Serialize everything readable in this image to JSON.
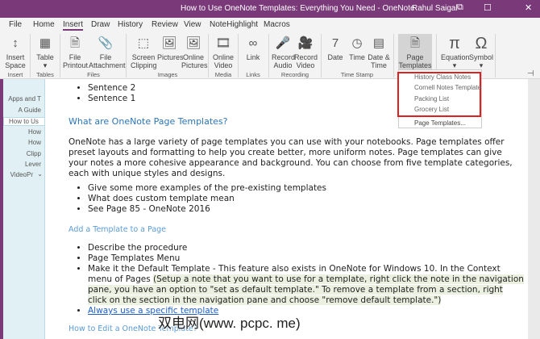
{
  "window": {
    "title": "How to Use OneNote Templates: Everything You Need  -  OneNote",
    "user": "Rahul Saigal"
  },
  "tabs": [
    "File",
    "Home",
    "Insert",
    "Draw",
    "History",
    "Review",
    "View",
    "NoteHighlight",
    "Macros"
  ],
  "ribbon": {
    "buttons": [
      {
        "l1": "Insert",
        "l2": "Space",
        "icon": "insert-space-icon",
        "g": "↕"
      },
      {
        "l1": "Table",
        "l2": "▾",
        "icon": "table-icon",
        "g": "▦"
      },
      {
        "l1": "File",
        "l2": "Printout",
        "icon": "file-printout-icon",
        "g": "🗎"
      },
      {
        "l1": "File",
        "l2": "Attachment",
        "icon": "attachment-icon",
        "g": "📎"
      },
      {
        "l1": "Screen",
        "l2": "Clipping",
        "icon": "screen-clipping-icon",
        "g": "⬚"
      },
      {
        "l1": "Pictures",
        "l2": "",
        "icon": "pictures-icon",
        "g": "🖼"
      },
      {
        "l1": "Online",
        "l2": "Pictures",
        "icon": "online-pictures-icon",
        "g": "🖼"
      },
      {
        "l1": "Online",
        "l2": "Video",
        "icon": "online-video-icon",
        "g": "🎞"
      },
      {
        "l1": "Link",
        "l2": "",
        "icon": "link-icon",
        "g": "∞"
      },
      {
        "l1": "Record",
        "l2": "Audio",
        "icon": "record-audio-icon",
        "g": "🎤"
      },
      {
        "l1": "Record",
        "l2": "Video",
        "icon": "record-video-icon",
        "g": "🎥"
      },
      {
        "l1": "Date",
        "l2": "",
        "icon": "date-icon",
        "g": "7"
      },
      {
        "l1": "Time",
        "l2": "",
        "icon": "time-icon",
        "g": "◷"
      },
      {
        "l1": "Date &",
        "l2": "Time",
        "icon": "date-time-icon",
        "g": "▤"
      },
      {
        "l1": "Page",
        "l2": "Templates ▾",
        "icon": "page-templates-icon",
        "g": "🗎"
      },
      {
        "l1": "Equation",
        "l2": "▾",
        "icon": "equation-icon",
        "g": "π"
      },
      {
        "l1": "Symbol",
        "l2": "▾",
        "icon": "symbol-icon",
        "g": "Ω"
      }
    ],
    "groups": [
      "Insert",
      "Tables",
      "Files",
      "Images",
      "Media",
      "Links",
      "Recording",
      "Time Stamp"
    ]
  },
  "sidebar": {
    "pages": [
      "Apps and T",
      "A Guide",
      "How to Us",
      "How",
      "How",
      "Clipp",
      "Lever",
      "VideoPr"
    ]
  },
  "dropdown": {
    "items": [
      "History Class Notes",
      "Cornell Notes Template",
      "Packing List",
      "Grocery List"
    ],
    "footer": "Page Templates..."
  },
  "content": {
    "top_bullets": [
      "Sentence 2",
      "Sentence 1"
    ],
    "heading1": "What are OneNote Page Templates?",
    "para": "OneNote has a large variety of page templates you can use with your notebooks. Page templates offer preset layouts and formatting to help you create better, more uniform notes. Page templates can give your notes a more cohesive appearance and background. You can choose from five template categories, each with unique styles and designs.",
    "bullets2": [
      "Give some more examples of the pre-existing templates",
      "What does custom template mean",
      "See Page 85 - OneNote 2016"
    ],
    "heading2": "Add a Template to a Page",
    "bullets3": [
      "Describe the procedure",
      "Page Templates Menu"
    ],
    "b3_main": "Make it the Default Template - This feature also exists in OneNote for Windows 10. In the Context menu of Pages ",
    "b3_hl": "(Setup a note that you want to use for a template, right click the note in the navigation pane, you have an option to \"set as default template.\" To remove a template from a section, right click on the section in the navigation pane and choose \"remove default template.\")",
    "link": "Always use a specific template",
    "heading3": "How to Edit a OneNote Template?"
  },
  "watermark": "双电网(www. pcpc. me)"
}
